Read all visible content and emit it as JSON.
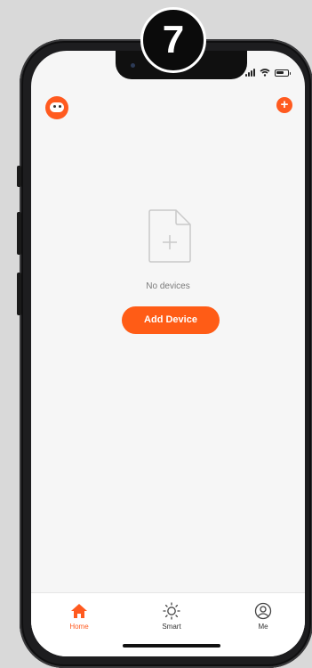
{
  "step_badge": "7",
  "header": {
    "avatar_icon": "robot-avatar-icon",
    "add_icon": "plus-circle-icon",
    "add_symbol": "+"
  },
  "empty_state": {
    "icon": "add-document-icon",
    "message": "No devices",
    "button_label": "Add Device"
  },
  "tabs": [
    {
      "label": "Home",
      "icon": "home-icon",
      "active": true
    },
    {
      "label": "Smart",
      "icon": "sun-icon",
      "active": false
    },
    {
      "label": "Me",
      "icon": "user-icon",
      "active": false
    }
  ],
  "colors": {
    "accent": "#ff5a1f",
    "screen_background": "#f6f6f6",
    "frame": "#1d1d1f"
  }
}
